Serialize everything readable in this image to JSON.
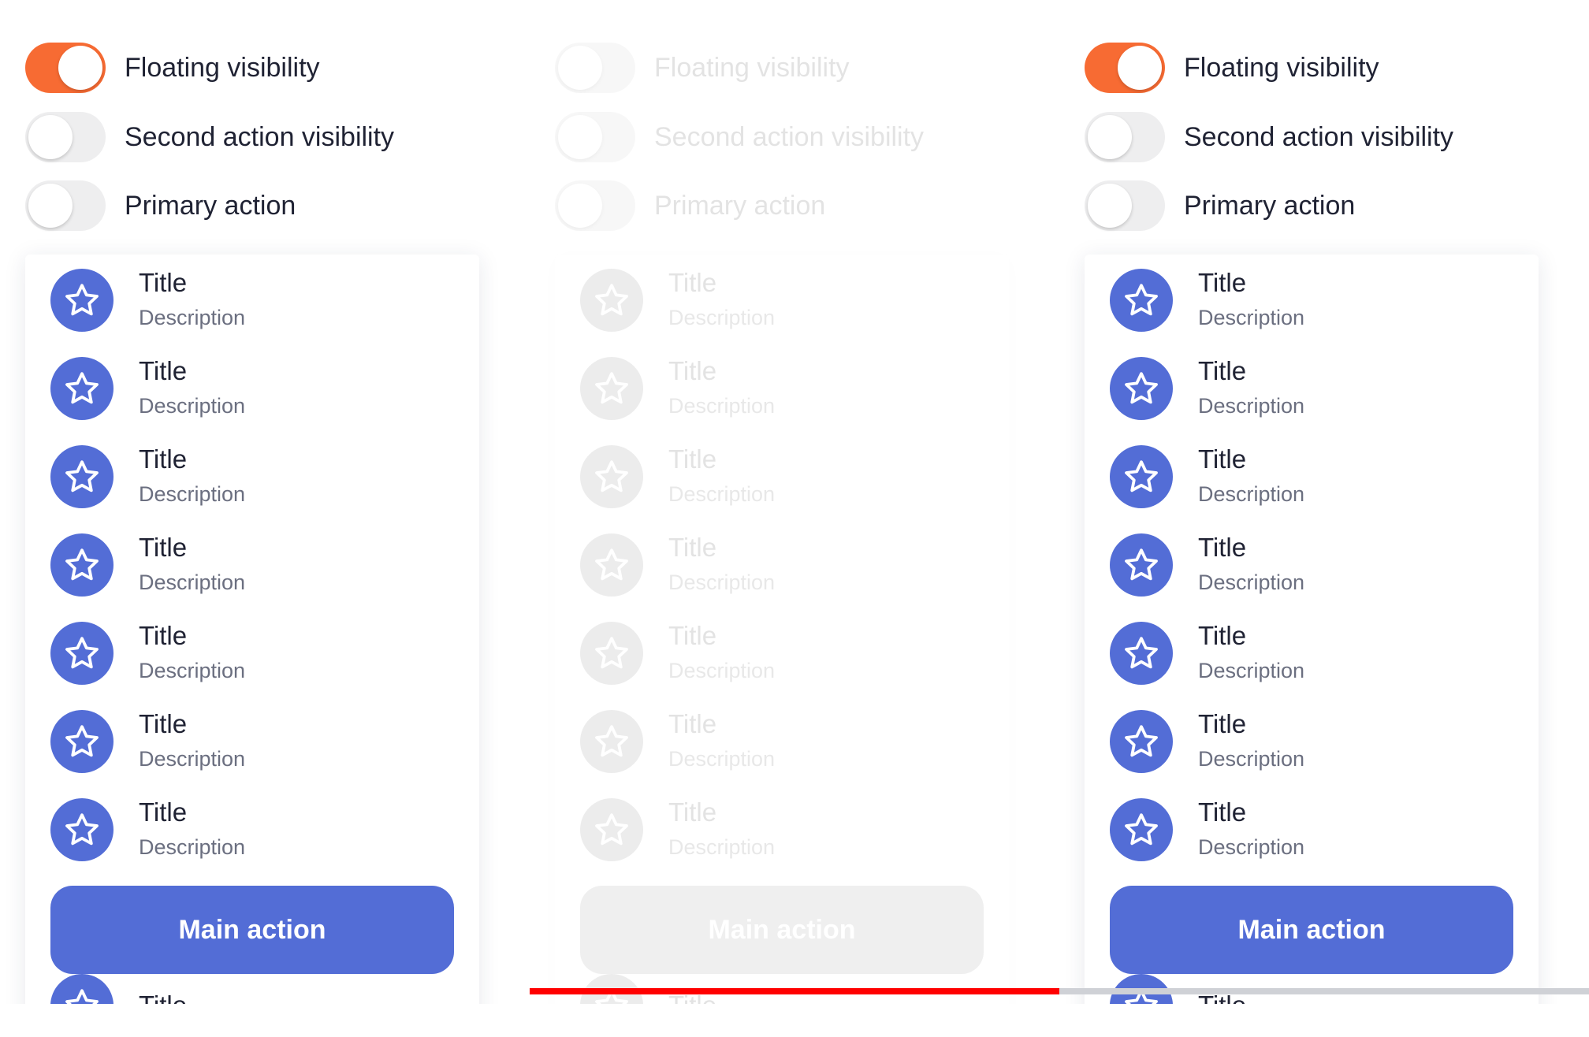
{
  "colors": {
    "toggle_on": "#f76b33",
    "toggle_off": "#eeeeef",
    "primary": "#536dd6",
    "text_primary": "#1f2233",
    "text_secondary": "#6b6f80",
    "scrollbar_thumb": "#ff0000",
    "scrollbar_track": "#cfd1d6"
  },
  "icons": {
    "list_item_icon": "star-icon"
  },
  "panels": [
    {
      "state": "enabled",
      "toggles": [
        {
          "label": "Floating visibility",
          "on": true
        },
        {
          "label": "Second action visibility",
          "on": false
        },
        {
          "label": "Primary action",
          "on": false
        }
      ],
      "items": [
        {
          "title": "Title",
          "description": "Description"
        },
        {
          "title": "Title",
          "description": "Description"
        },
        {
          "title": "Title",
          "description": "Description"
        },
        {
          "title": "Title",
          "description": "Description"
        },
        {
          "title": "Title",
          "description": "Description"
        },
        {
          "title": "Title",
          "description": "Description"
        },
        {
          "title": "Title",
          "description": "Description"
        }
      ],
      "main_action_label": "Main action",
      "trailing_item_title": "Title"
    },
    {
      "state": "disabled",
      "toggles": [
        {
          "label": "Floating visibility",
          "on": false
        },
        {
          "label": "Second action visibility",
          "on": false
        },
        {
          "label": "Primary action",
          "on": false
        }
      ],
      "items": [
        {
          "title": "Title",
          "description": "Description"
        },
        {
          "title": "Title",
          "description": "Description"
        },
        {
          "title": "Title",
          "description": "Description"
        },
        {
          "title": "Title",
          "description": "Description"
        },
        {
          "title": "Title",
          "description": "Description"
        },
        {
          "title": "Title",
          "description": "Description"
        },
        {
          "title": "Title",
          "description": "Description"
        }
      ],
      "main_action_label": "Main action",
      "trailing_item_title": "Title"
    },
    {
      "state": "enabled",
      "toggles": [
        {
          "label": "Floating visibility",
          "on": true
        },
        {
          "label": "Second action visibility",
          "on": false
        },
        {
          "label": "Primary action",
          "on": false
        }
      ],
      "items": [
        {
          "title": "Title",
          "description": "Description"
        },
        {
          "title": "Title",
          "description": "Description"
        },
        {
          "title": "Title",
          "description": "Description"
        },
        {
          "title": "Title",
          "description": "Description"
        },
        {
          "title": "Title",
          "description": "Description"
        },
        {
          "title": "Title",
          "description": "Description"
        },
        {
          "title": "Title",
          "description": "Description"
        }
      ],
      "main_action_label": "Main action",
      "trailing_item_title": "Title"
    }
  ],
  "horizontal_scroll": {
    "position_fraction": 0.5
  }
}
